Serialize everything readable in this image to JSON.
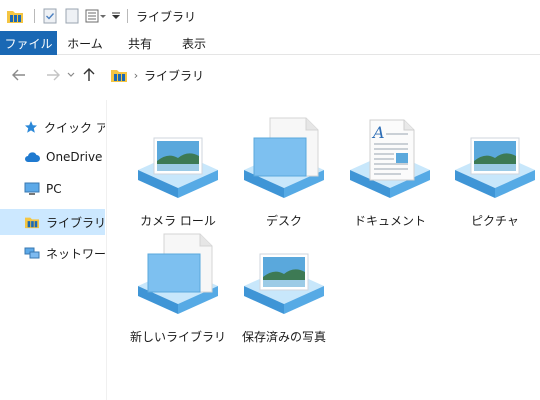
{
  "window": {
    "title": "ライブラリ"
  },
  "ribbon": {
    "tabs": [
      "ファイル",
      "ホーム",
      "共有",
      "表示"
    ]
  },
  "address": {
    "path": [
      "ライブラリ"
    ]
  },
  "sidebar": {
    "items": [
      {
        "label": "クイック アクセス",
        "icon": "star-icon"
      },
      {
        "label": "OneDrive - Personal",
        "icon": "cloud-icon"
      },
      {
        "label": "PC",
        "icon": "pc-icon"
      },
      {
        "label": "ライブラリ",
        "icon": "library-icon",
        "selected": true
      },
      {
        "label": "ネットワーク",
        "icon": "network-icon"
      }
    ]
  },
  "libraries": [
    {
      "label": "カメラ ロール",
      "icon": "photo-library-icon"
    },
    {
      "label": "デスク",
      "icon": "document-library-icon"
    },
    {
      "label": "ドキュメント",
      "icon": "documents-library-icon"
    },
    {
      "label": "ピクチャ",
      "icon": "pictures-library-icon"
    },
    {
      "label": "新しいライブラリ",
      "icon": "new-library-icon"
    },
    {
      "label": "保存済みの写真",
      "icon": "saved-photos-library-icon"
    }
  ],
  "colors": {
    "accent": "#1a68b4",
    "selection": "#cce8ff",
    "folder": "#f4c542",
    "library_base": "#4fa3e0"
  }
}
